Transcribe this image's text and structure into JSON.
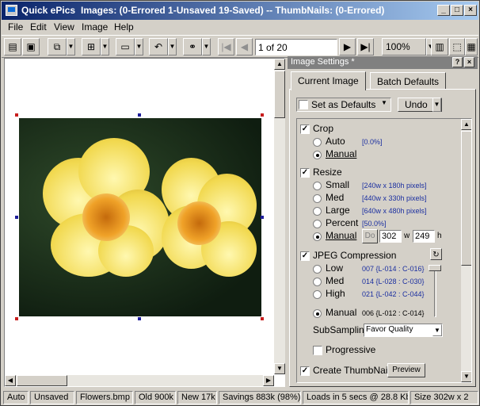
{
  "title": {
    "app": "Quick ePics",
    "info": "Images: (0-Errored  1-Unsaved  19-Saved) -- ThumbNails: (0-Errored)"
  },
  "menu": [
    "File",
    "Edit",
    "View",
    "Image",
    "Help"
  ],
  "toolbar": {
    "page": "1 of 20",
    "zoom": "100%"
  },
  "panel": {
    "title": "Image Settings *",
    "tabs": [
      "Current Image",
      "Batch Defaults"
    ],
    "set_defaults": "Set as Defaults",
    "undo": "Undo",
    "crop": {
      "label": "Crop",
      "auto": "Auto",
      "auto_val": "[0.0%]",
      "manual": "Manual"
    },
    "resize": {
      "label": "Resize",
      "small": "Small",
      "small_val": "[240w x 180h pixels]",
      "med": "Med",
      "med_val": "[440w x 330h pixels]",
      "large": "Large",
      "large_val": "[640w x 480h pixels]",
      "percent": "Percent",
      "percent_val": "[50.0%]",
      "manual": "Manual",
      "do": "Do",
      "width": "302",
      "w": "w",
      "height": "249",
      "h": "h"
    },
    "jpeg": {
      "label": "JPEG Compression",
      "low": "Low",
      "low_val": "007 {L-014 : C-016}",
      "med": "Med",
      "med_val": "014 {L-028 : C-030}",
      "high": "High",
      "high_val": "021 {L-042 : C-044}",
      "manual": "Manual",
      "manual_val": "006 {L-012 : C-014}"
    },
    "subsampling": {
      "label": "SubSampling",
      "value": "Favor Quality"
    },
    "progressive": "Progressive",
    "thumbnail": "Create ThumbNail",
    "preview": "Preview"
  },
  "status": [
    "Auto",
    "Unsaved",
    "Flowers.bmp",
    "Old 900k",
    "New 17k",
    "Savings 883k (98%)",
    "Loads in 5 secs @ 28.8 Kb",
    "Size 302w x 2"
  ],
  "colors": {
    "title_start": "#0a246a",
    "title_end": "#a6caf0",
    "accent_value": "#1b2fa0",
    "crop_handle": "#c81e1e",
    "crop_handle_alt": "#1e1e9a"
  }
}
